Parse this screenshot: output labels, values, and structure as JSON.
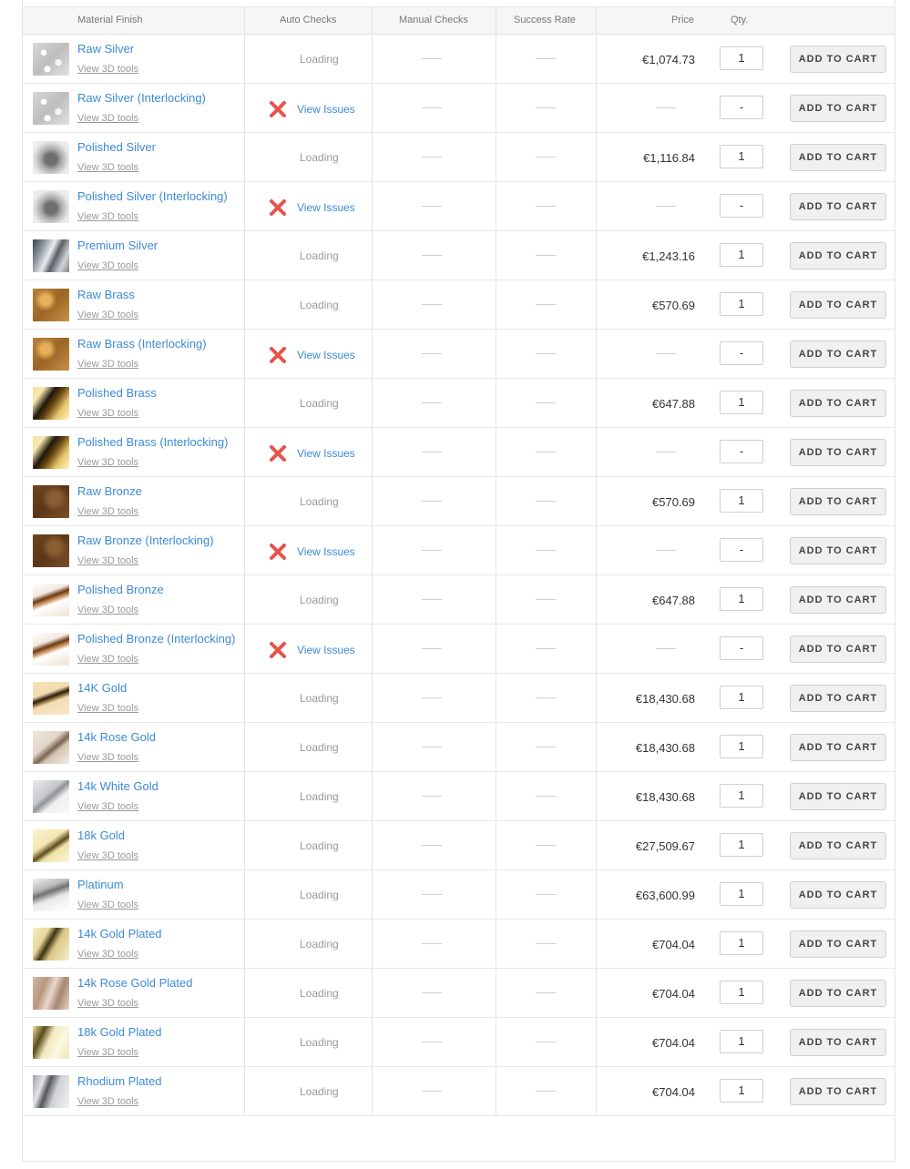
{
  "headers": {
    "material_finish": "Material Finish",
    "auto_checks": "Auto Checks",
    "manual_checks": "Manual Checks",
    "success_rate": "Success Rate",
    "price": "Price",
    "qty": "Qty."
  },
  "labels": {
    "view_tools": "View 3D tools",
    "loading": "Loading",
    "view_issues": "View Issues",
    "add_to_cart": "ADD TO CART"
  },
  "colors": {
    "link": "#3c8ad6",
    "error_icon": "#e5534b"
  },
  "materials": [
    {
      "name": "Raw Silver",
      "status": "loading",
      "price": "€1,074.73",
      "qty": "1",
      "swatch": "silver-raw"
    },
    {
      "name": "Raw Silver (Interlocking)",
      "status": "issues",
      "price": "",
      "qty": "-",
      "swatch": "silver-raw"
    },
    {
      "name": "Polished Silver",
      "status": "loading",
      "price": "€1,116.84",
      "qty": "1",
      "swatch": "silver-polished"
    },
    {
      "name": "Polished Silver (Interlocking)",
      "status": "issues",
      "price": "",
      "qty": "-",
      "swatch": "silver-polished"
    },
    {
      "name": "Premium Silver",
      "status": "loading",
      "price": "€1,243.16",
      "qty": "1",
      "swatch": "silver-premium"
    },
    {
      "name": "Raw Brass",
      "status": "loading",
      "price": "€570.69",
      "qty": "1",
      "swatch": "brass-raw"
    },
    {
      "name": "Raw Brass (Interlocking)",
      "status": "issues",
      "price": "",
      "qty": "-",
      "swatch": "brass-raw"
    },
    {
      "name": "Polished Brass",
      "status": "loading",
      "price": "€647.88",
      "qty": "1",
      "swatch": "brass-polished"
    },
    {
      "name": "Polished Brass (Interlocking)",
      "status": "issues",
      "price": "",
      "qty": "-",
      "swatch": "brass-polished"
    },
    {
      "name": "Raw Bronze",
      "status": "loading",
      "price": "€570.69",
      "qty": "1",
      "swatch": "bronze-raw"
    },
    {
      "name": "Raw Bronze (Interlocking)",
      "status": "issues",
      "price": "",
      "qty": "-",
      "swatch": "bronze-raw"
    },
    {
      "name": "Polished Bronze",
      "status": "loading",
      "price": "€647.88",
      "qty": "1",
      "swatch": "bronze-polished"
    },
    {
      "name": "Polished Bronze (Interlocking)",
      "status": "issues",
      "price": "",
      "qty": "-",
      "swatch": "bronze-polished"
    },
    {
      "name": "14K Gold",
      "status": "loading",
      "price": "€18,430.68",
      "qty": "1",
      "swatch": "gold-14k"
    },
    {
      "name": "14k Rose Gold",
      "status": "loading",
      "price": "€18,430.68",
      "qty": "1",
      "swatch": "gold-rose"
    },
    {
      "name": "14k White Gold",
      "status": "loading",
      "price": "€18,430.68",
      "qty": "1",
      "swatch": "gold-white"
    },
    {
      "name": "18k Gold",
      "status": "loading",
      "price": "€27,509.67",
      "qty": "1",
      "swatch": "gold-18k"
    },
    {
      "name": "Platinum",
      "status": "loading",
      "price": "€63,600.99",
      "qty": "1",
      "swatch": "platinum"
    },
    {
      "name": "14k Gold Plated",
      "status": "loading",
      "price": "€704.04",
      "qty": "1",
      "swatch": "gold-plated"
    },
    {
      "name": "14k Rose Gold Plated",
      "status": "loading",
      "price": "€704.04",
      "qty": "1",
      "swatch": "rose-plated"
    },
    {
      "name": "18k Gold Plated",
      "status": "loading",
      "price": "€704.04",
      "qty": "1",
      "swatch": "gold18-plated"
    },
    {
      "name": "Rhodium Plated",
      "status": "loading",
      "price": "€704.04",
      "qty": "1",
      "swatch": "rhodium"
    }
  ]
}
